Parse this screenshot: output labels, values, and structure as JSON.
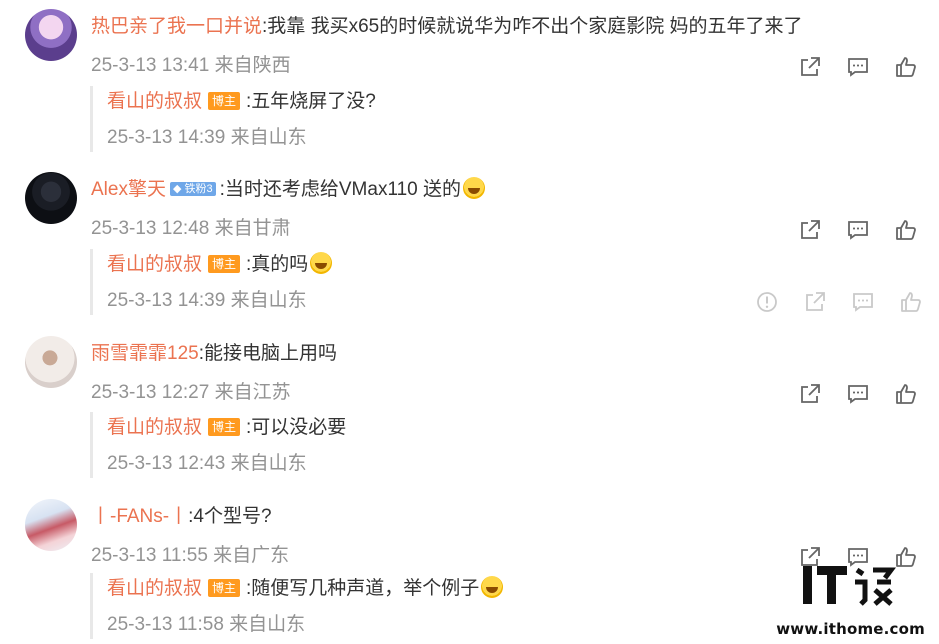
{
  "comments": [
    {
      "user": "热巴亲了我一口并说",
      "text": ":我靠 我买x65的时候就说华为咋不出个家庭影院 妈的五年了来了",
      "date": "25-3-13 13:41 来自陕西",
      "reply": {
        "user": "看山的叔叔",
        "badge": "博主",
        "text": ":五年烧屏了没?",
        "date": "25-3-13 14:39 来自山东"
      }
    },
    {
      "user": "Alex擎天",
      "fan_badge": "◆ 铁粉3",
      "text": ":当时还考虑给VMax110 送的",
      "date": "25-3-13 12:48 来自甘肃",
      "reply": {
        "user": "看山的叔叔",
        "badge": "博主",
        "text": ":真的吗",
        "date": "25-3-13 14:39 来自山东"
      }
    },
    {
      "user": "雨雪霏霏125",
      "text": ":能接电脑上用吗",
      "date": "25-3-13 12:27 来自江苏",
      "reply": {
        "user": "看山的叔叔",
        "badge": "博主",
        "text": ":可以没必要",
        "date": "25-3-13 12:43 来自山东"
      }
    },
    {
      "user": "丨-FANs-丨",
      "text": ":4个型号?",
      "date": "25-3-13 11:55 来自广东",
      "reply": {
        "user": "看山的叔叔",
        "badge": "博主",
        "text": ":随便写几种声道，举个例子",
        "date": "25-3-13 11:58 来自山东"
      }
    }
  ],
  "icons": {
    "share": "share-icon",
    "comment": "comment-icon",
    "like": "like-icon",
    "report": "report-icon"
  },
  "watermark": {
    "url": "www.ithome.com"
  },
  "colors": {
    "username": "#eb7350",
    "meta": "#939393",
    "badge": "#ff9a1f"
  }
}
